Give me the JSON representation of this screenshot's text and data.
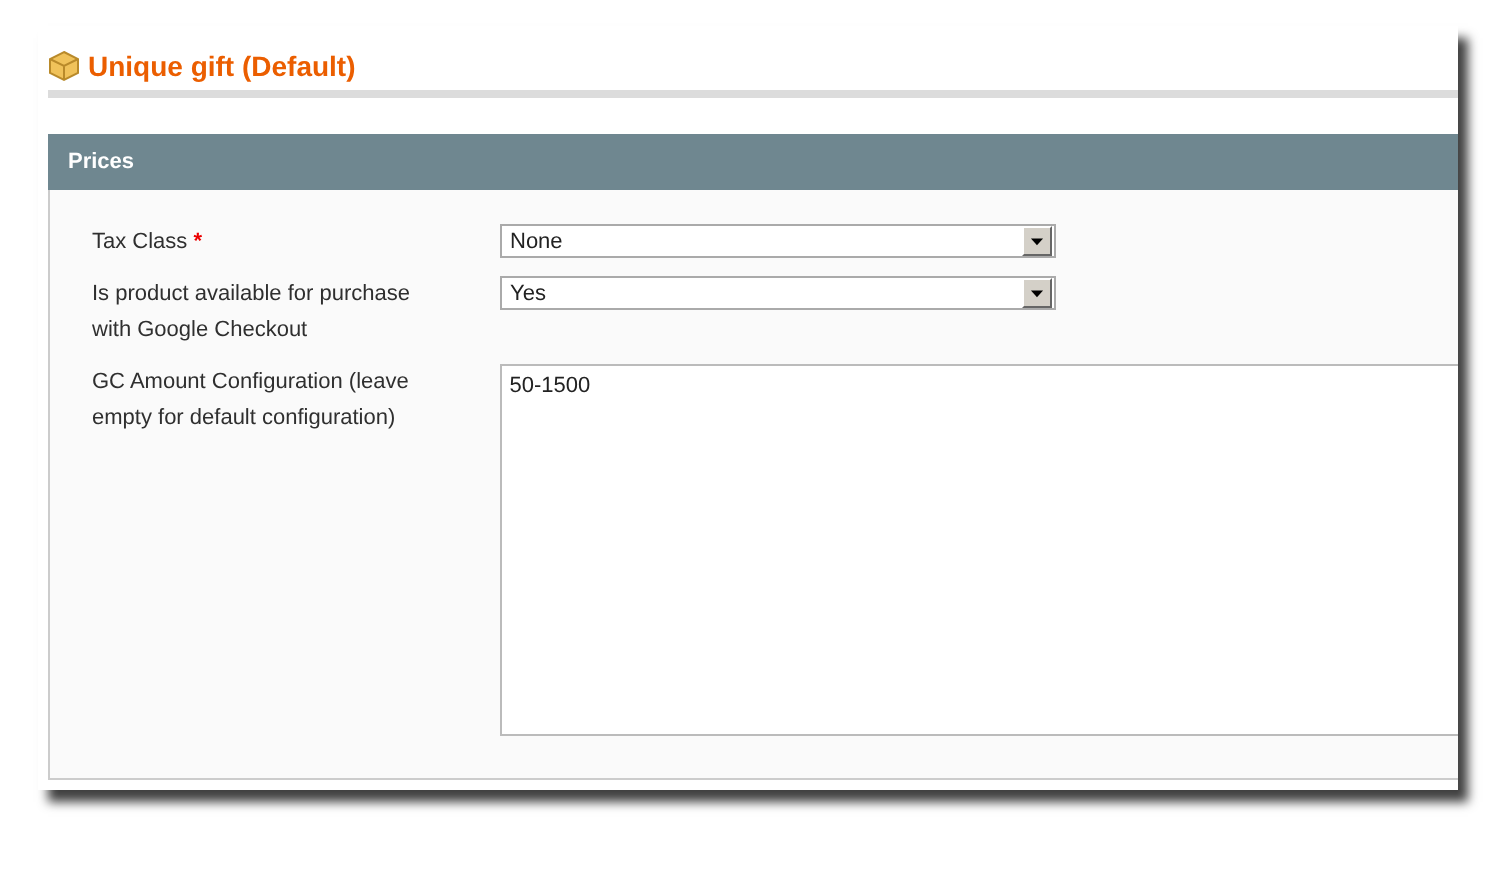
{
  "page_title": "Unique gift (Default)",
  "section": {
    "title": "Prices"
  },
  "fields": [
    {
      "kind": "select",
      "label": "Tax Class",
      "required_mark": "*",
      "value": "None"
    },
    {
      "kind": "select",
      "label": "Is product available for purchase with Google Checkout",
      "value": "Yes"
    },
    {
      "kind": "textarea",
      "label": "GC Amount Configuration (leave empty for default configuration)",
      "value": "50-1500"
    }
  ]
}
